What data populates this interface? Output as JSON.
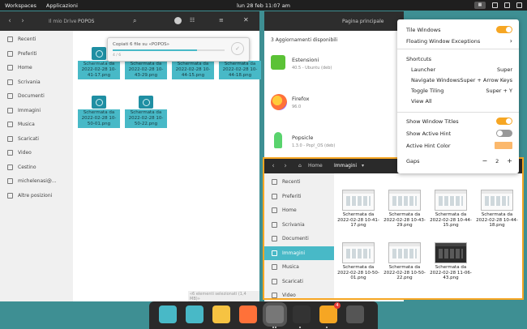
{
  "topbar": {
    "workspaces": "Workspaces",
    "apps": "Applicazioni",
    "clock": "lun 28 feb  11:07 am"
  },
  "files_left": {
    "breadcrumb": [
      "Il mio Drive",
      "POPOS"
    ],
    "progress": {
      "title": "Copiati 6 file su «POPOS»",
      "detail": "4 / 6",
      "fraction": 0.75
    },
    "sidebar": [
      {
        "label": "Recenti",
        "icon": "clock-icon"
      },
      {
        "label": "Preferiti",
        "icon": "star-icon"
      },
      {
        "label": "Home",
        "icon": "home-icon"
      },
      {
        "label": "Scrivania",
        "icon": "desktop-icon"
      },
      {
        "label": "Documenti",
        "icon": "document-icon"
      },
      {
        "label": "Immagini",
        "icon": "image-icon"
      },
      {
        "label": "Musica",
        "icon": "music-icon"
      },
      {
        "label": "Scaricati",
        "icon": "download-icon"
      },
      {
        "label": "Video",
        "icon": "video-icon"
      },
      {
        "label": "Cestino",
        "icon": "trash-icon"
      },
      {
        "label": "michelenasi@...",
        "icon": "cloud-icon"
      },
      {
        "label": "Altre posizioni",
        "icon": "plus-icon"
      }
    ],
    "files": [
      "Schermata da 2022-02-28 10-41-17.png",
      "Schermata da 2022-02-28 10-43-29.png",
      "Schermata da 2022-02-28 10-44-15.png",
      "Schermata da 2022-02-28 10-44-18.png",
      "Schermata da 2022-02-28 10-50-01.png",
      "Schermata da 2022-02-28 10-50-22.png"
    ],
    "status": "«6 elementi selezionati (1,4 MB)»"
  },
  "store": {
    "title": "Pagina principale",
    "updates_header": "3 Aggiornamenti disponibili",
    "updates": [
      {
        "name": "Estensioni",
        "detail": "40.5 - Ubuntu (deb)"
      },
      {
        "name": "Firefox",
        "detail": "96.0"
      },
      {
        "name": "Popsicle",
        "detail": "1.3.0 - Pop!_OS (deb)"
      }
    ]
  },
  "files_right": {
    "breadcrumb": [
      "Home",
      "Immagini"
    ],
    "sidebar": [
      {
        "label": "Recenti",
        "icon": "clock-icon"
      },
      {
        "label": "Preferiti",
        "icon": "star-icon"
      },
      {
        "label": "Home",
        "icon": "home-icon"
      },
      {
        "label": "Scrivania",
        "icon": "desktop-icon"
      },
      {
        "label": "Documenti",
        "icon": "document-icon"
      },
      {
        "label": "Immagini",
        "icon": "image-icon"
      },
      {
        "label": "Musica",
        "icon": "music-icon"
      },
      {
        "label": "Scaricati",
        "icon": "download-icon"
      },
      {
        "label": "Video",
        "icon": "video-icon"
      }
    ],
    "active_index": 5,
    "files": [
      {
        "name": "Schermata da 2022-02-28 10-41-17.png",
        "dark": false
      },
      {
        "name": "Schermata da 2022-02-28 10-43-29.png",
        "dark": false
      },
      {
        "name": "Schermata da 2022-02-28 10-44-15.png",
        "dark": false
      },
      {
        "name": "Schermata da 2022-02-28 10-44-18.png",
        "dark": false
      },
      {
        "name": "Schermata da 2022-02-28 10-50-01.png",
        "dark": false
      },
      {
        "name": "Schermata da 2022-02-28 10-50-22.png",
        "dark": false
      },
      {
        "name": "Schermata da 2022-02-28 11-06-43.png",
        "dark": true
      }
    ]
  },
  "tiling_menu": {
    "tile_windows": "Tile Windows",
    "floating_exceptions": "Floating Window Exceptions",
    "shortcuts_header": "Shortcuts",
    "shortcuts": [
      {
        "action": "Launcher",
        "keys": "Super"
      },
      {
        "action": "Navigate Windows",
        "keys": "Super + Arrow Keys"
      },
      {
        "action": "Toggle Tiling",
        "keys": "Super + Y"
      },
      {
        "action": "View All",
        "keys": ""
      }
    ],
    "show_titles": "Show Window Titles",
    "show_hint": "Show Active Hint",
    "hint_color": "Active Hint Color",
    "hint_color_value": "#fbb86c",
    "gaps": "Gaps",
    "gaps_value": "2",
    "tile_windows_on": true,
    "show_titles_on": true,
    "show_hint_on": false
  },
  "dock": {
    "apps": [
      {
        "name": "search-app-icon",
        "color": "#48b9c7"
      },
      {
        "name": "workspaces-app-icon",
        "color": "#48b9c7"
      },
      {
        "name": "app-grid-icon",
        "color": "#f6c342"
      },
      {
        "name": "firefox-icon",
        "color": "#ff7139"
      },
      {
        "name": "files-icon",
        "color": "#777777"
      },
      {
        "name": "terminal-icon",
        "color": "#333333"
      },
      {
        "name": "pop-shop-icon",
        "color": "#f6a623"
      },
      {
        "name": "settings-icon",
        "color": "#555555"
      }
    ],
    "shop_badge": "4"
  },
  "accent": "#48b9c7"
}
